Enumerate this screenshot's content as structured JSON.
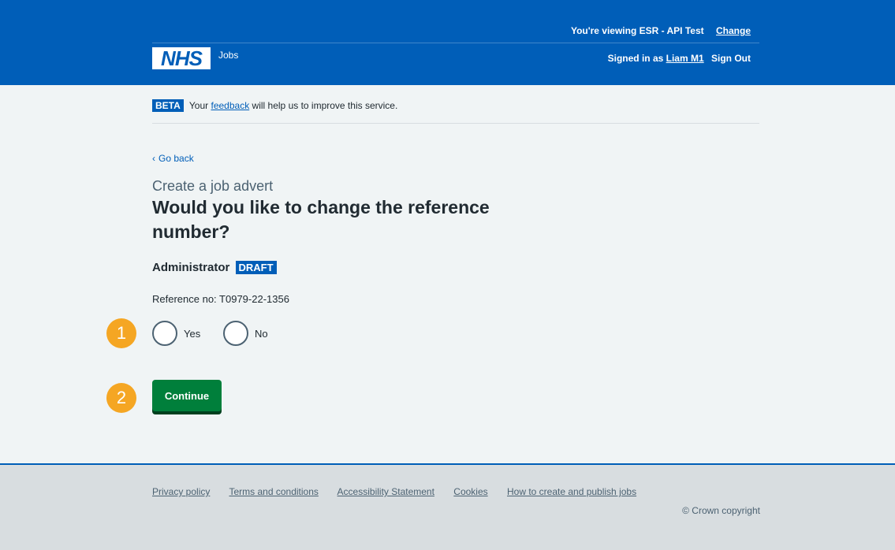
{
  "header": {
    "viewing_prefix": "You're viewing ESR - API Test",
    "change_label": "Change",
    "logo_text": "NHS",
    "service_name": "Jobs",
    "signed_in_prefix": "Signed in as",
    "user_name": "Liam M1",
    "sign_out_label": "Sign Out"
  },
  "beta_banner": {
    "tag": "BETA",
    "text_before": "Your",
    "link": "feedback",
    "text_after": "will help us to improve this service."
  },
  "main": {
    "back_label": "Go back",
    "caption": "Create a job advert",
    "heading": "Would you like to change the reference number?",
    "job_title": "Administrator",
    "status_badge": "DRAFT",
    "reference_text": "Reference no: T0979-22-1356",
    "options": [
      {
        "label": "Yes",
        "selected": false
      },
      {
        "label": "No",
        "selected": false
      }
    ],
    "continue_label": "Continue"
  },
  "markers": [
    "1",
    "2"
  ],
  "footer": {
    "links": [
      "Privacy policy",
      "Terms and conditions",
      "Accessibility Statement",
      "Cookies",
      "How to create and publish jobs"
    ],
    "copyright": "© Crown copyright"
  },
  "colors": {
    "header_blue": "#005eb8",
    "page_background": "#f0f4f5",
    "button_green": "#007f3b",
    "marker_orange": "#f5a623",
    "footer_background": "#d8dde0"
  }
}
